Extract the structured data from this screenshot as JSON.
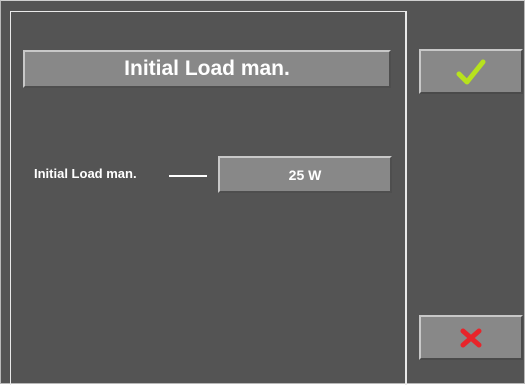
{
  "title": "Initial Load man.",
  "parameter": {
    "label": "Initial Load man.",
    "value": "25 W"
  },
  "buttons": {
    "confirm_icon": "checkmark-icon",
    "cancel_icon": "close-icon"
  },
  "colors": {
    "background": "#545454",
    "button_face": "#888888",
    "check_green": "#b7e21d",
    "cancel_red": "#e8242a"
  }
}
